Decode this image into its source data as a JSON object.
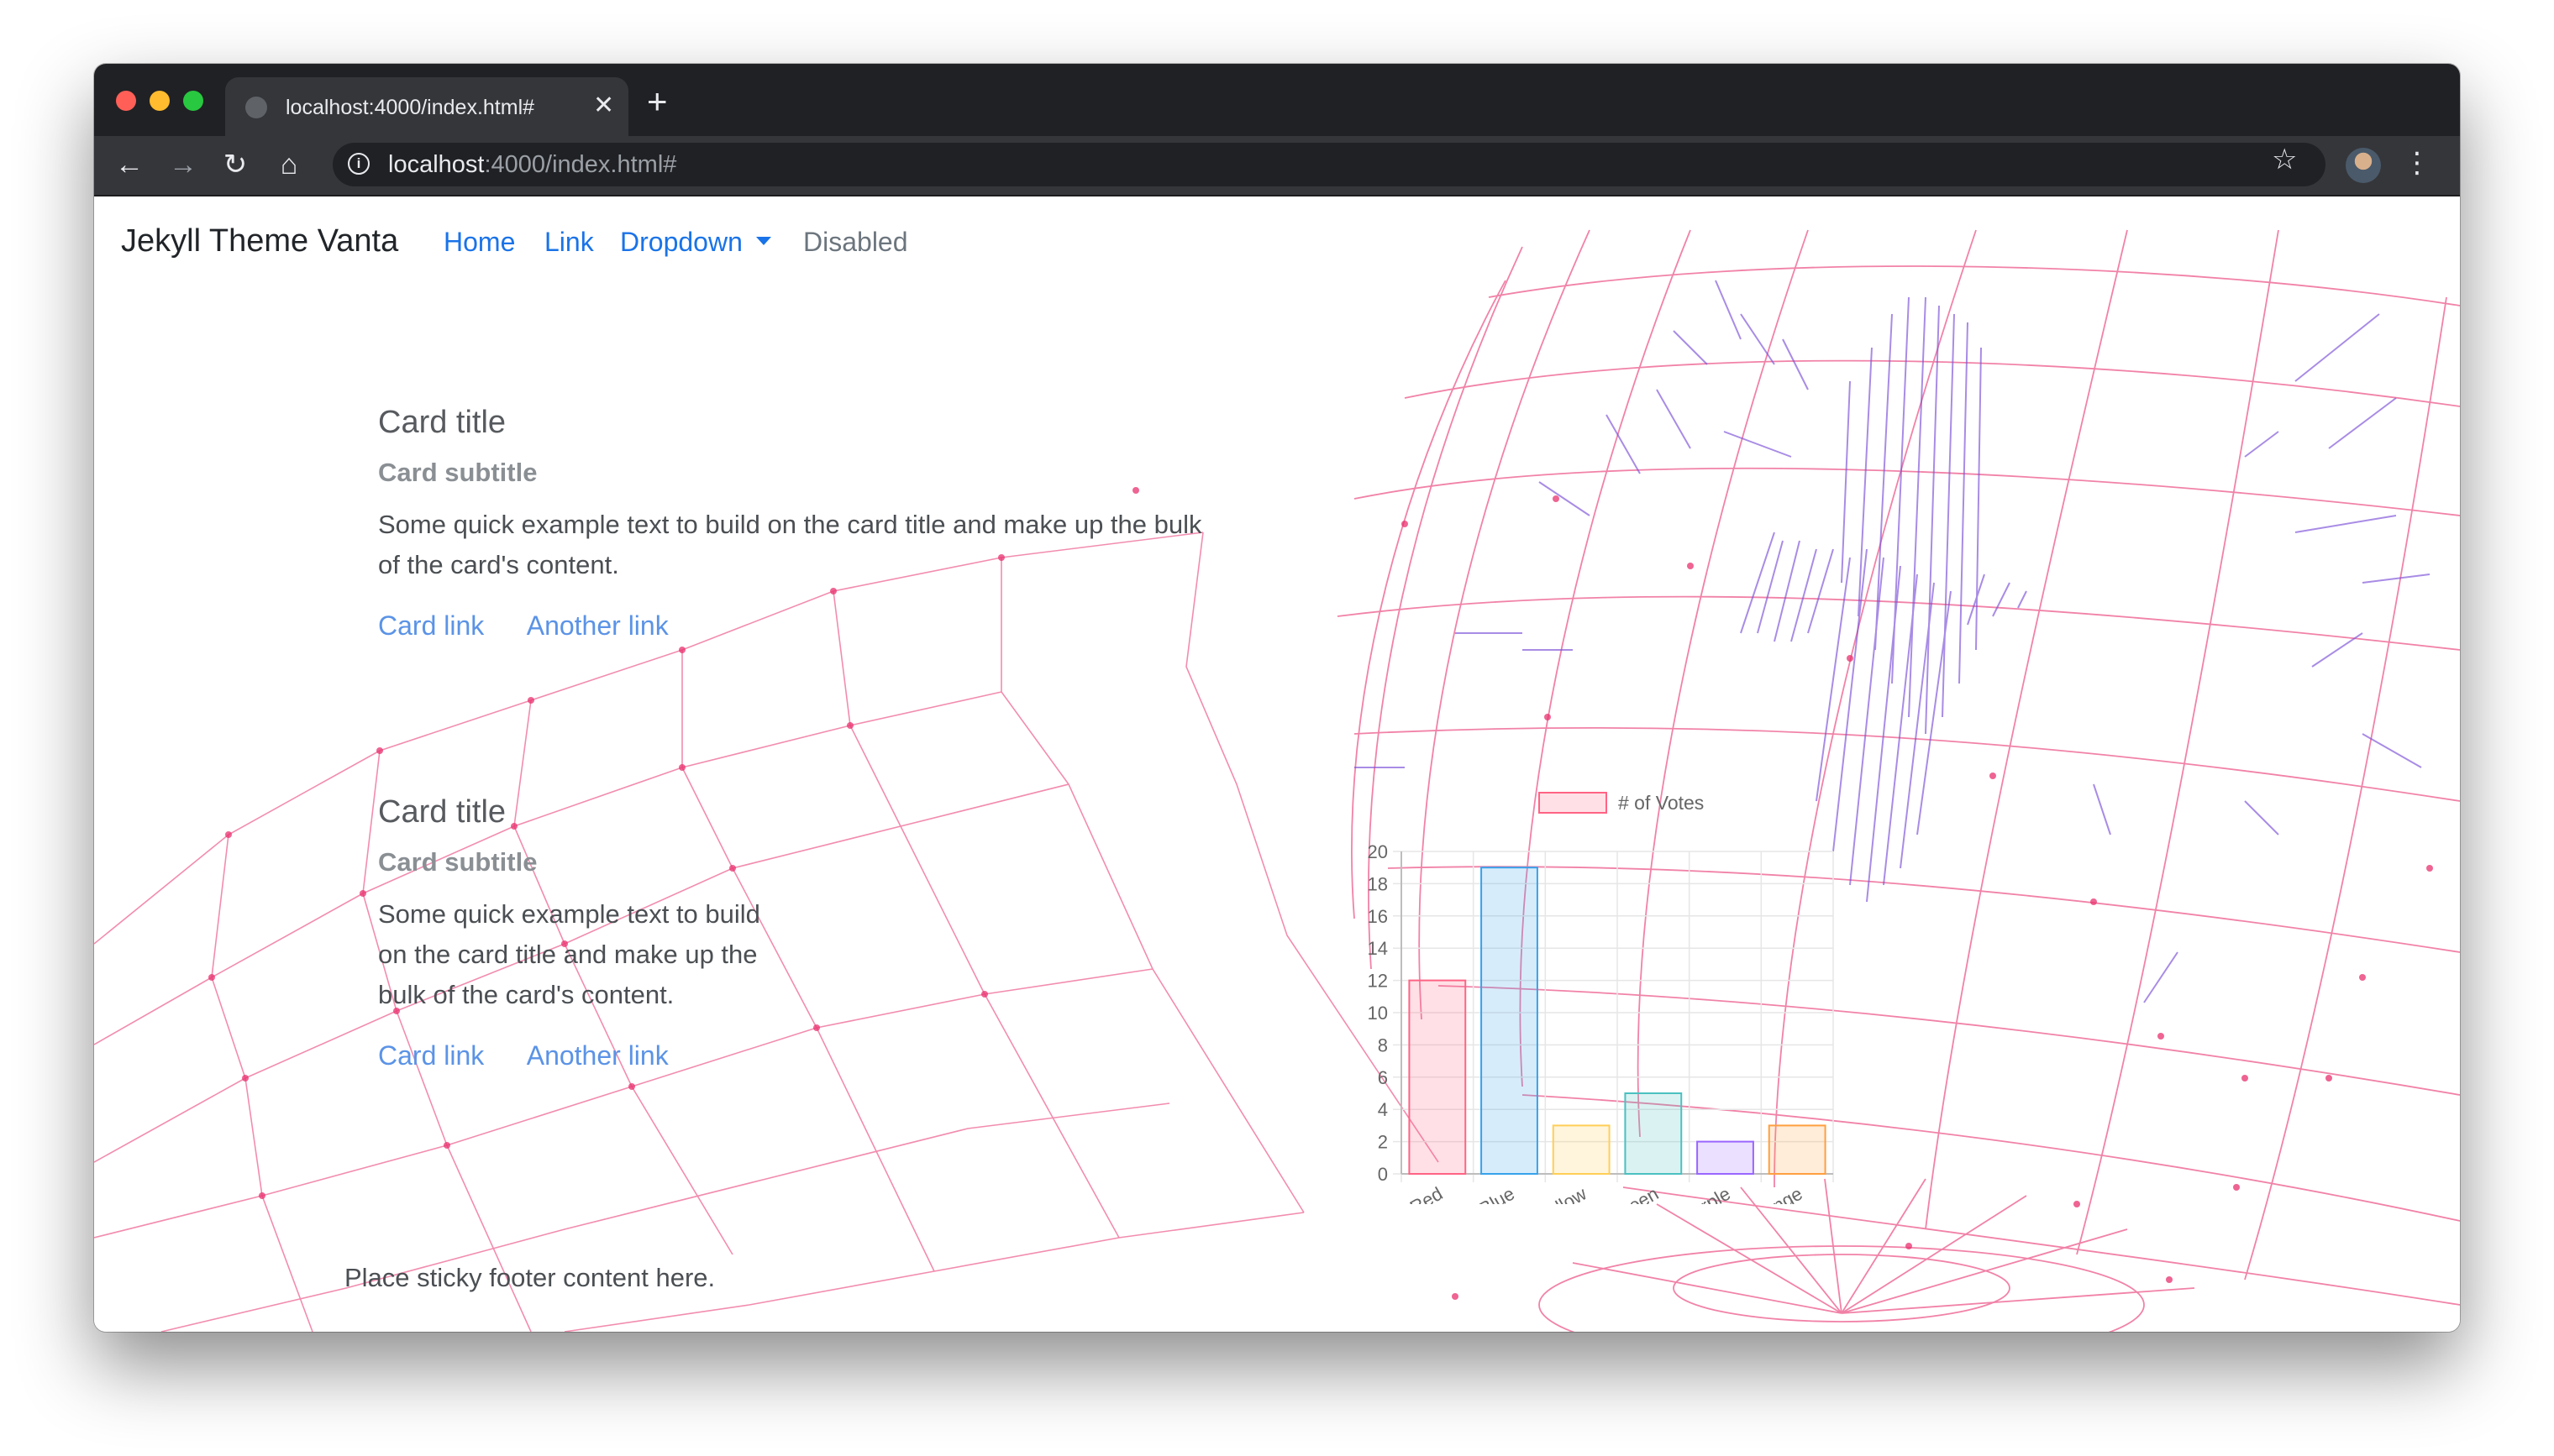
{
  "browser": {
    "tab_title": "localhost:4000/index.html#",
    "new_tab": "+",
    "tab_close": "✕",
    "url_host": "localhost",
    "url_rest": ":4000/index.html#",
    "icons": {
      "back": "←",
      "forward": "→",
      "reload": "↻",
      "home": "⌂",
      "info": "i",
      "bookmark": "☆",
      "menu": "⋮"
    }
  },
  "navbar": {
    "brand": "Jekyll Theme Vanta",
    "links": {
      "home": "Home",
      "link": "Link",
      "dropdown": "Dropdown",
      "disabled": "Disabled"
    }
  },
  "cards": [
    {
      "title": "Card title",
      "subtitle": "Card subtitle",
      "text": "Some quick example text to build on the card title and make up the bulk of the card's content.",
      "link1": "Card link",
      "link2": "Another link"
    },
    {
      "title": "Card title",
      "subtitle": "Card subtitle",
      "text": "Some quick example text to build on the card title and make up the bulk of the card's content.",
      "link1": "Card link",
      "link2": "Another link"
    }
  ],
  "footer": {
    "text": "Place sticky footer content here."
  },
  "colors": {
    "link_blue": "#1a73e8",
    "card_link": "#5b93e6",
    "mesh_pink": "#e8306e",
    "globe_purple": "#7b4fd8"
  },
  "chart_data": {
    "type": "bar",
    "categories": [
      "Red",
      "Blue",
      "Yellow",
      "Green",
      "Purple",
      "Orange"
    ],
    "series": [
      {
        "name": "# of Votes",
        "values": [
          12,
          19,
          3,
          5,
          2,
          3
        ]
      }
    ],
    "ylim": [
      0,
      20
    ],
    "y_ticks": [
      "0",
      "2",
      "4",
      "6",
      "8",
      "10",
      "12",
      "14",
      "16",
      "18",
      "20"
    ],
    "grid": true,
    "legend": "top",
    "bar_fills": [
      "rgba(255,99,132,0.2)",
      "rgba(54,162,235,0.2)",
      "rgba(255,206,86,0.2)",
      "rgba(75,192,192,0.2)",
      "rgba(153,102,255,0.2)",
      "rgba(255,159,64,0.2)"
    ],
    "bar_borders": [
      "#ff6384",
      "#36a2eb",
      "#ffce56",
      "#4bc0c0",
      "#9966ff",
      "#ff9f40"
    ]
  }
}
